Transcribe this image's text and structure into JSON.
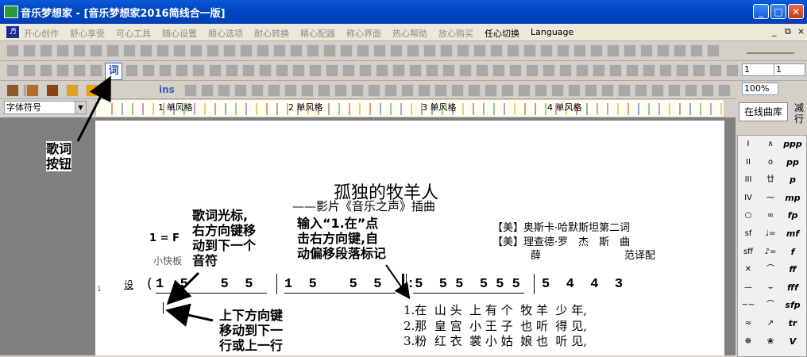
{
  "window": {
    "title": "音乐梦想家 - [音乐梦想家2016简线合一版]"
  },
  "menu": {
    "items": [
      "开心创作",
      "舒心享受",
      "可心工具",
      "随心设置",
      "顺心选项",
      "耐心转换",
      "精心配器",
      "称心界面",
      "热心帮助",
      "放心购买",
      "任心切换",
      "Language"
    ],
    "active_items": [
      "任心切换",
      "Language"
    ],
    "mdi_controls": [
      "_",
      "⧉",
      "×"
    ]
  },
  "toolbar": {
    "lyric_button": "词",
    "ins_label": "ins",
    "field1": "1",
    "field2": "1",
    "zoom": "100%"
  },
  "font_select": {
    "value": "字体符号"
  },
  "ruler": {
    "labels": [
      "1 单风格",
      "2 单风格",
      "3 单风格",
      "4 单风格"
    ]
  },
  "right_panel": {
    "online_button": "在线曲库",
    "side_label": "减行",
    "palette": [
      [
        "I",
        "∧",
        "ppp"
      ],
      [
        "II",
        "o",
        "pp"
      ],
      [
        "III",
        "廿",
        "p"
      ],
      [
        "IV",
        "⁓",
        "mp"
      ],
      [
        "○",
        "∞",
        "fp"
      ],
      [
        "sf",
        "♩=",
        "mf"
      ],
      [
        "sff",
        "♪=",
        "f"
      ],
      [
        "✕",
        "⌒",
        "ff"
      ],
      [
        "—",
        "⌣",
        "fff"
      ],
      [
        "~~",
        "⌒",
        "sfp"
      ],
      [
        "≈",
        "↗",
        "tr"
      ],
      [
        "☸",
        "❀",
        "V"
      ]
    ]
  },
  "score": {
    "title": "孤独的牧羊人",
    "subtitle": "——影片《音乐之声》插曲",
    "credits_right": [
      "【美】奥斯卡·哈默斯坦第二词",
      "【美】理查德·罗　杰　斯　曲"
    ],
    "credits_bottom": [
      "薛",
      "范译配"
    ],
    "key": "1 = F",
    "tempo": "小快板",
    "lyric_mark": "设",
    "line_number": "1",
    "measures": [
      "1  5    5  5",
      "1  5    5  5",
      ":5  5 5  5 5 5",
      "5  4  4  3"
    ],
    "lyrics": [
      "1.在  山 头  上 有 个  牧 羊  少 年,",
      "2.那  皇 宫  小 王 子  也 听  得 见,",
      "3.粉  红 衣  裳 小 姑  娘 也  听 见,"
    ]
  },
  "annotations": {
    "lyric_button_note": "歌词\n按钮",
    "cursor_note": "歌词光标,\n右方向键移\n动到下一个\n音符",
    "input_note": "输入“1.在”点\n击右方向键,自\n动偏移段落标记",
    "updown_note": "上下方向键\n移动到下一\n行或上一行"
  }
}
